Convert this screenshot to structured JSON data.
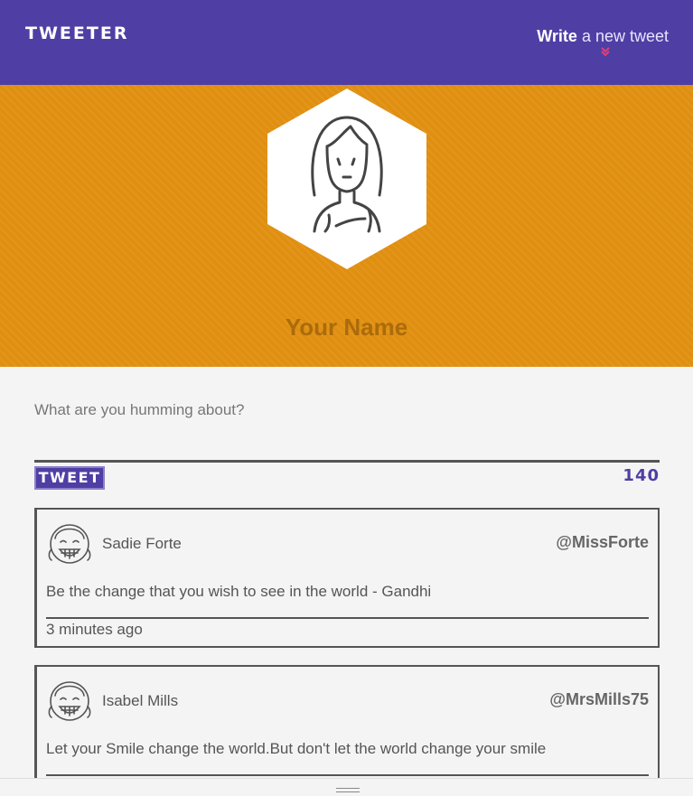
{
  "header": {
    "logo": "TWEETER",
    "write_bold": "Write",
    "write_rest": "a new tweet",
    "chevron_icon": "double-chevron-down-icon",
    "accent": "#e0407a"
  },
  "profile": {
    "avatar_icon": "girl-avatar-icon",
    "name": "Your Name"
  },
  "compose": {
    "placeholder": "What are you humming about?",
    "button_label": "TWEET",
    "char_count": "140"
  },
  "tweets": [
    {
      "author": "Sadie Forte",
      "handle": "@MissForte",
      "text": "Be the change that you wish to see in the world - Gandhi",
      "time": "3 minutes ago",
      "avatar_icon": "smiling-girl-avatar-icon"
    },
    {
      "author": "Isabel Mills",
      "handle": "@MrsMills75",
      "text": "Let your Smile change the world.But don't let the world change your smile",
      "time": "",
      "avatar_icon": "smiling-girl-avatar-icon"
    }
  ],
  "colors": {
    "header_bg": "#4f3fa4",
    "hero_bg": "#e08f10",
    "page_bg": "#f5f4f4"
  }
}
